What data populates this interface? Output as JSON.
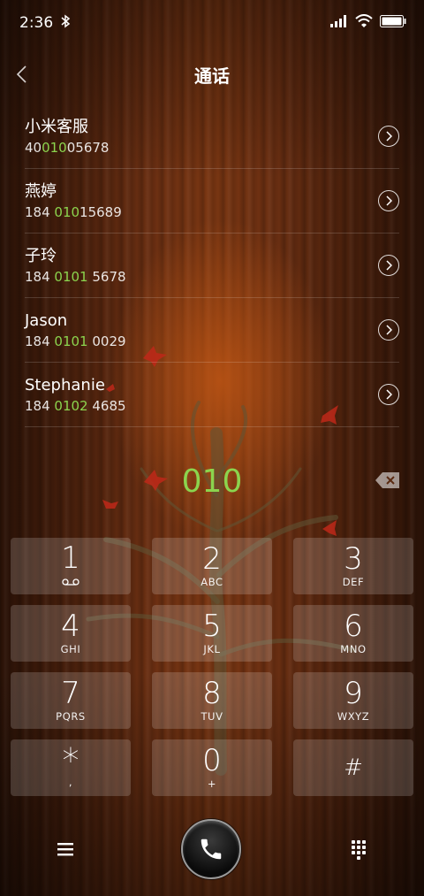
{
  "status_bar": {
    "time": "2:36"
  },
  "header": {
    "title": "通话"
  },
  "contacts": [
    {
      "name": "小米客服",
      "number_pre": "40",
      "number_match": "010",
      "number_post": "05678"
    },
    {
      "name": "燕婷",
      "number_pre": "184 ",
      "number_match": "010",
      "number_post": "15689"
    },
    {
      "name": "子玲",
      "number_pre": "184 ",
      "number_match": "0101",
      "number_post": " 5678"
    },
    {
      "name": "Jason",
      "number_pre": "184 ",
      "number_match": "0101",
      "number_post": " 0029"
    },
    {
      "name": "Stephanie",
      "number_pre": "184 ",
      "number_match": "0102",
      "number_post": " 4685"
    }
  ],
  "dialer": {
    "entered": "010",
    "accent_color": "#8bd44e"
  },
  "keypad": {
    "k1": {
      "digit": "1",
      "sub_icon": "voicemail-icon"
    },
    "k2": {
      "digit": "2",
      "letters": "ABC"
    },
    "k3": {
      "digit": "3",
      "letters": "DEF"
    },
    "k4": {
      "digit": "4",
      "letters": "GHI"
    },
    "k5": {
      "digit": "5",
      "letters": "JKL"
    },
    "k6": {
      "digit": "6",
      "letters": "MNO"
    },
    "k7": {
      "digit": "7",
      "letters": "PQRS"
    },
    "k8": {
      "digit": "8",
      "letters": "TUV"
    },
    "k9": {
      "digit": "9",
      "letters": "WXYZ"
    },
    "kstar": {
      "digit": "*",
      "letters": ","
    },
    "k0": {
      "digit": "0",
      "letters": "+"
    },
    "khash": {
      "digit": "#"
    }
  },
  "bottom_bar": {
    "menu_icon": "menu-icon",
    "call_icon": "phone-icon",
    "dialpad_icon": "dialpad-icon"
  }
}
